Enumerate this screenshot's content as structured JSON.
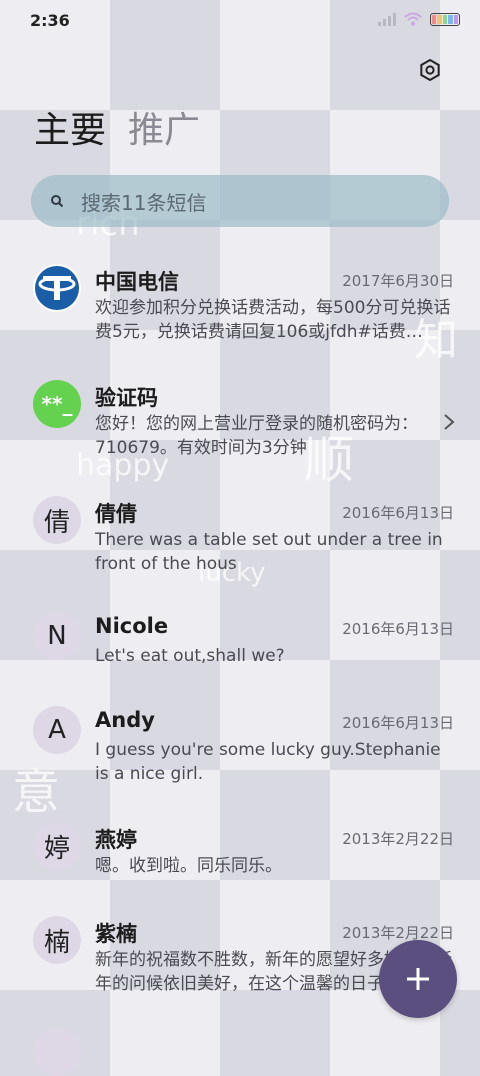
{
  "status_bar": {
    "time": "2:36"
  },
  "tabs": [
    {
      "label": "主要",
      "active": true
    },
    {
      "label": "推广",
      "active": false
    }
  ],
  "search": {
    "placeholder": "搜索11条短信"
  },
  "messages": [
    {
      "sender": "中国电信",
      "date": "2017年6月30日",
      "preview": "欢迎参加积分兑换话费活动，每500分可兑换话费5元，兑换话费请回复106或jfdh#话费…",
      "avatar_type": "logo-icon"
    },
    {
      "sender": "验证码",
      "date": "",
      "preview": "您好！您的网上营业厅登录的随机密码为：710679。有效时间为3分钟",
      "avatar_text": "**_"
    },
    {
      "sender": "倩倩",
      "date": "2016年6月13日",
      "preview": "There was a table set out under a tree in front of the hous",
      "avatar_text": "倩"
    },
    {
      "sender": "Nicole",
      "date": "2016年6月13日",
      "preview": "Let's eat out,shall we?",
      "avatar_text": "N"
    },
    {
      "sender": "Andy",
      "date": "2016年6月13日",
      "preview": "I guess you're some lucky guy.Stephanie is a nice girl.",
      "avatar_text": "A"
    },
    {
      "sender": "燕婷",
      "date": "2013年2月22日",
      "preview": "嗯。收到啦。同乐同乐。",
      "avatar_text": "婷"
    },
    {
      "sender": "紫楠",
      "date": "2013年2月22日",
      "preview": "新年的祝福数不胜数，新年的愿望好多好多，新年的问候依旧美好，在这个温馨的日子里",
      "avatar_text": "楠"
    }
  ],
  "background_words": {
    "rich": "rich",
    "happy": "happy",
    "lucky": "lucky",
    "zhi": "知",
    "shun": "顺",
    "yi": "意"
  },
  "colors": {
    "accent": "#5a4f7e",
    "search_bg": "#96b9c3",
    "verify_green": "#64d24e",
    "telecom_blue": "#1a5ea8"
  },
  "icons": {
    "settings": "gear-icon",
    "search": "search-icon",
    "compose": "plus-icon",
    "chevron": "chevron-right-icon"
  }
}
